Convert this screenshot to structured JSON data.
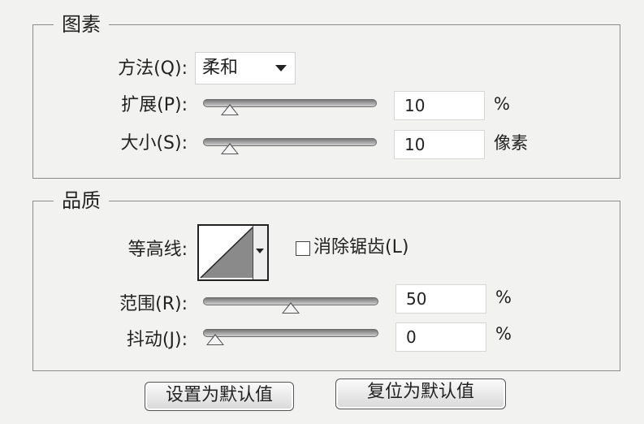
{
  "elements": {
    "title": "图素",
    "method_label": "方法(Q):",
    "method_value": "柔和",
    "spread_label": "扩展(P):",
    "spread_value": "10",
    "spread_unit": "%",
    "spread_fraction": 0.1,
    "size_label": "大小(S):",
    "size_value": "10",
    "size_unit": "像素",
    "size_fraction": 0.1
  },
  "quality": {
    "title": "品质",
    "contour_label": "等高线:",
    "antialias_label": "消除锯齿(L)",
    "antialias_checked": false,
    "range_label": "范围(R):",
    "range_value": "50",
    "range_unit": "%",
    "range_fraction": 0.5,
    "jitter_label": "抖动(J):",
    "jitter_value": "0",
    "jitter_unit": "%",
    "jitter_fraction": 0.0
  },
  "buttons": {
    "set_default": "设置为默认值",
    "reset_default": "复位为默认值"
  },
  "colors": {
    "background": "#f2f2f0",
    "contour_fill": "#8a8a8a"
  }
}
